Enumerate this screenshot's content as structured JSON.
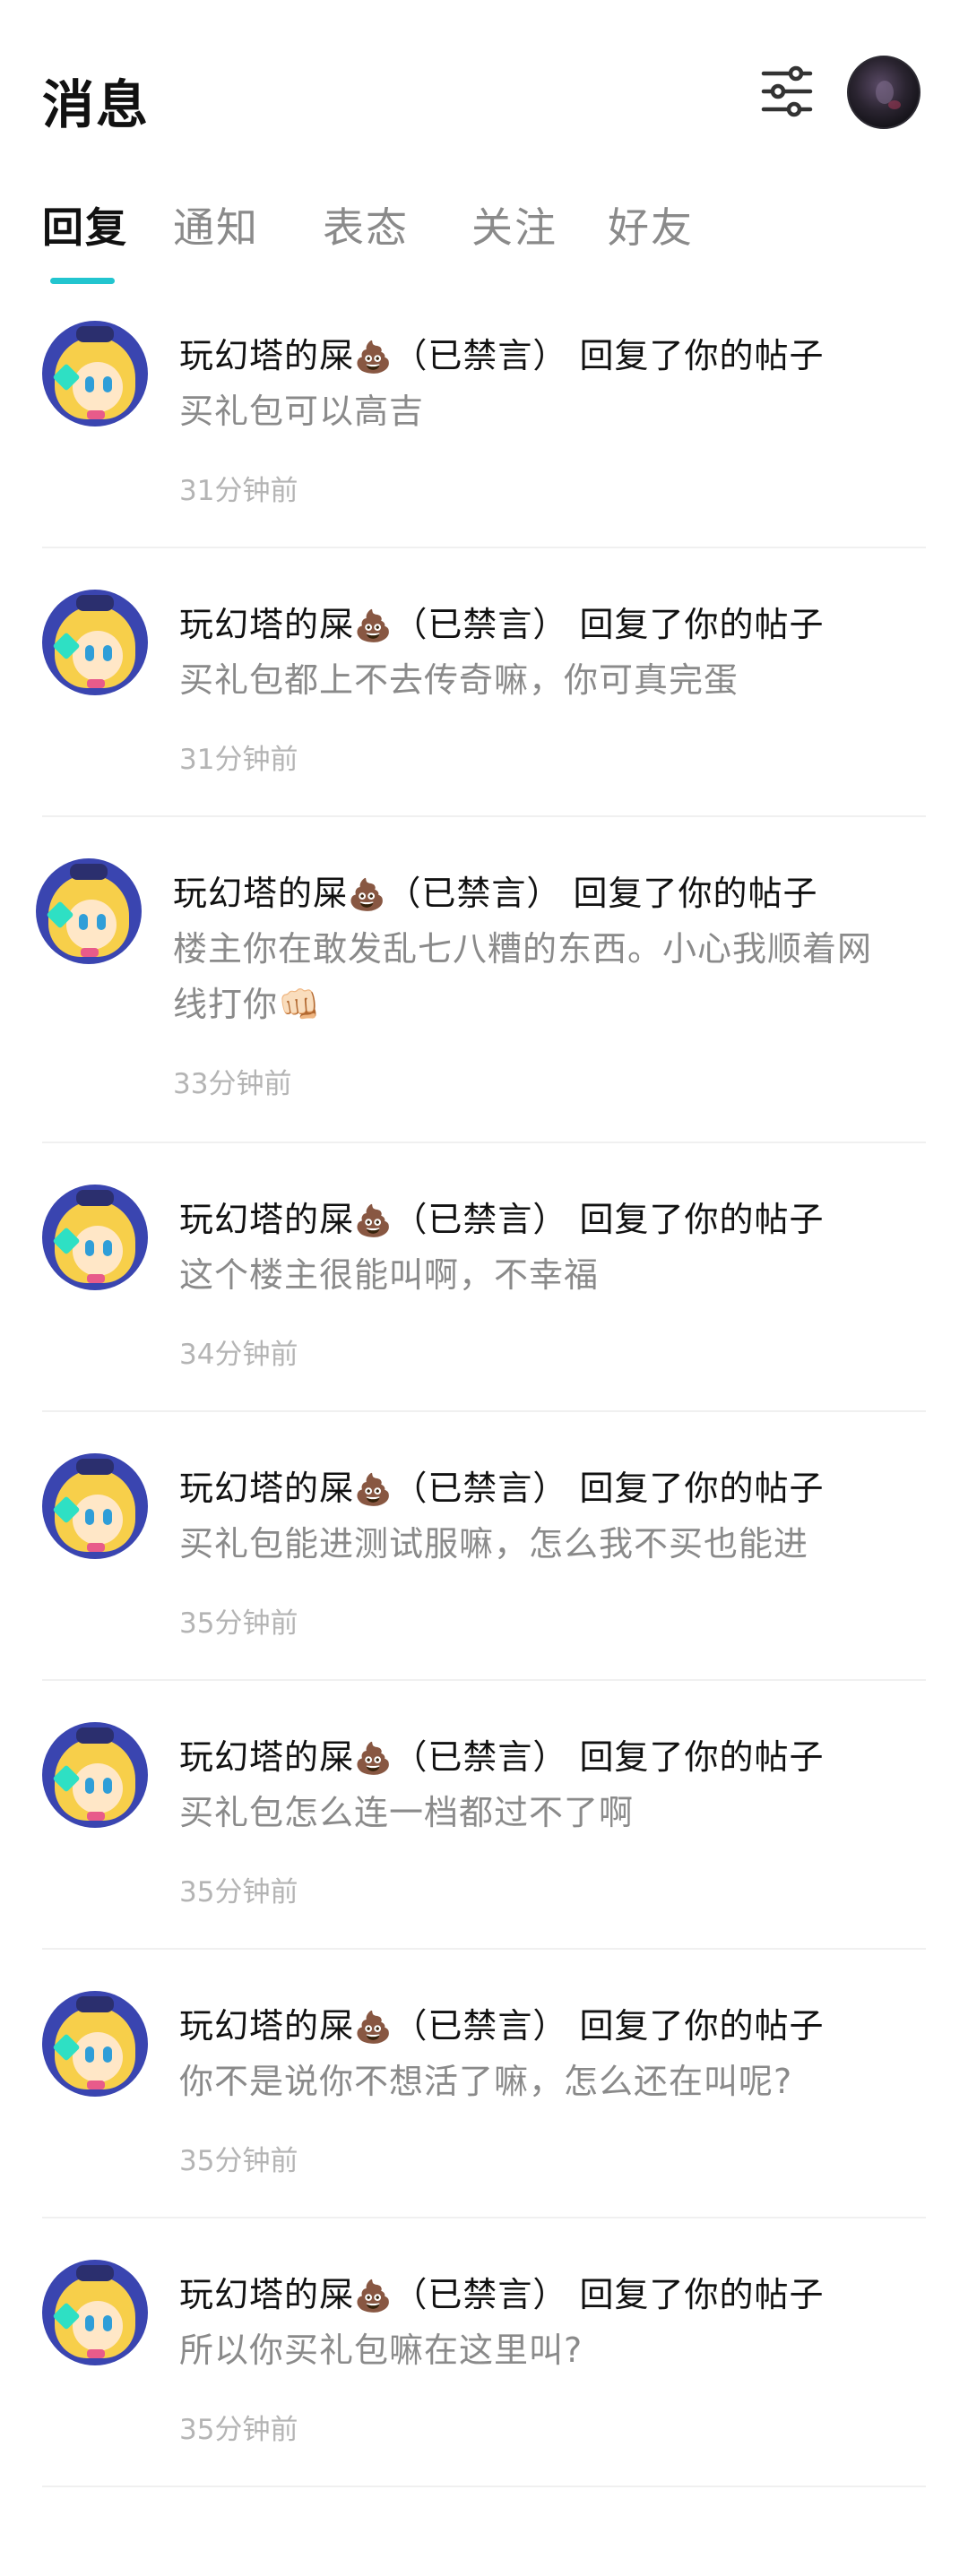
{
  "header": {
    "title": "消息",
    "filter_icon": "sliders-icon",
    "avatar_icon": "user-avatar"
  },
  "tabs": [
    {
      "label": "回复",
      "active": true
    },
    {
      "label": "通知",
      "active": false
    },
    {
      "label": "表态",
      "active": false
    },
    {
      "label": "关注",
      "active": false
    },
    {
      "label": "好友",
      "active": false
    }
  ],
  "accent_color": "#22c5cf",
  "replies": [
    {
      "user": "玩幻塔的屎",
      "emoji": "💩",
      "muted_tag": "（已禁言）",
      "action": "回复了你的帖子",
      "content": "买礼包可以高吉",
      "time": "31分钟前"
    },
    {
      "user": "玩幻塔的屎",
      "emoji": "💩",
      "muted_tag": "（已禁言）",
      "action": "回复了你的帖子",
      "content": "买礼包都上不去传奇嘛，你可真完蛋",
      "time": "31分钟前"
    },
    {
      "user": "玩幻塔的屎",
      "emoji": "💩",
      "muted_tag": "（已禁言）",
      "action": "回复了你的帖子",
      "content": "楼主你在敢发乱七八糟的东西。小心我顺着网线打你👊🏻",
      "time": "33分钟前"
    },
    {
      "user": "玩幻塔的屎",
      "emoji": "💩",
      "muted_tag": "（已禁言）",
      "action": "回复了你的帖子",
      "content": "这个楼主很能叫啊，不幸福",
      "time": "34分钟前"
    },
    {
      "user": "玩幻塔的屎",
      "emoji": "💩",
      "muted_tag": "（已禁言）",
      "action": "回复了你的帖子",
      "content": "买礼包能进测试服嘛，怎么我不买也能进",
      "time": "35分钟前"
    },
    {
      "user": "玩幻塔的屎",
      "emoji": "💩",
      "muted_tag": "（已禁言）",
      "action": "回复了你的帖子",
      "content": "买礼包怎么连一档都过不了啊",
      "time": "35分钟前"
    },
    {
      "user": "玩幻塔的屎",
      "emoji": "💩",
      "muted_tag": "（已禁言）",
      "action": "回复了你的帖子",
      "content": "你不是说你不想活了嘛，怎么还在叫呢?",
      "time": "35分钟前"
    },
    {
      "user": "玩幻塔的屎",
      "emoji": "💩",
      "muted_tag": "（已禁言）",
      "action": "回复了你的帖子",
      "content": "所以你买礼包嘛在这里叫?",
      "time": "35分钟前"
    }
  ]
}
